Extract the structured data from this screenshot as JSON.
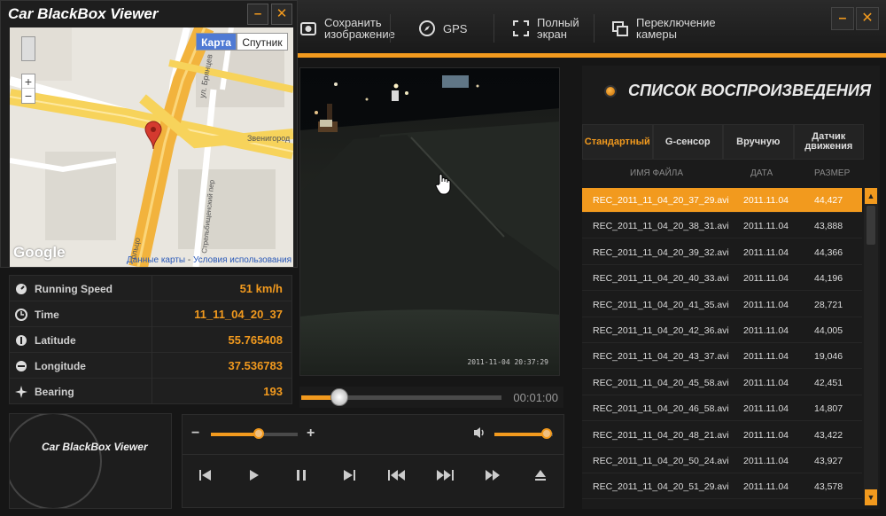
{
  "app": {
    "title": "Car BlackBox Viewer",
    "minimize": "–",
    "close": "✕"
  },
  "toolbar": {
    "save": "Сохранить изображение",
    "gps": "GPS",
    "fullscreen": "Полный экран",
    "switch_camera": "Переключение камеры"
  },
  "map": {
    "type_map": "Карта",
    "type_satellite": "Спутник",
    "zoom_in": "+",
    "zoom_out": "−",
    "google": "Google",
    "map_data": "Данные карты",
    "separator": "-",
    "terms": "Условия использования",
    "streets": [
      "ул. Брянцев",
      "Звенигород",
      "Стрельбищенский пер",
      "ольцо"
    ]
  },
  "telemetry": [
    {
      "label": "Running Speed",
      "value": "51 km/h",
      "icon": "speed-icon"
    },
    {
      "label": "Time",
      "value": "11_11_04_20_37",
      "icon": "clock-icon"
    },
    {
      "label": "Latitude",
      "value": "55.765408",
      "icon": "latitude-icon"
    },
    {
      "label": "Longitude",
      "value": "37.536783",
      "icon": "longitude-icon"
    },
    {
      "label": "Bearing",
      "value": "193",
      "icon": "bearing-icon"
    }
  ],
  "logo": {
    "text": "Car BlackBox Viewer"
  },
  "video": {
    "osd": "2011-11-04 20:37:29",
    "progress": 0.19,
    "time": "00:01:00"
  },
  "controls": {
    "zoom_minus": "−",
    "zoom_plus": "+",
    "zoom_level": 0.55,
    "volume_level": 0.9
  },
  "playlist": {
    "title": "СПИСОК ВОСПРОИЗВЕДЕНИЯ",
    "tabs": [
      "Стандартный",
      "G-сенсор",
      "Вручную",
      "Датчик движения"
    ],
    "columns": [
      "ИМЯ ФАЙЛА",
      "ДАТА",
      "РАЗМЕР"
    ],
    "selected_index": 0,
    "rows": [
      {
        "name": "REC_2011_11_04_20_37_29.avi",
        "date": "2011.11.04",
        "size": "44,427"
      },
      {
        "name": "REC_2011_11_04_20_38_31.avi",
        "date": "2011.11.04",
        "size": "43,888"
      },
      {
        "name": "REC_2011_11_04_20_39_32.avi",
        "date": "2011.11.04",
        "size": "44,366"
      },
      {
        "name": "REC_2011_11_04_20_40_33.avi",
        "date": "2011.11.04",
        "size": "44,196"
      },
      {
        "name": "REC_2011_11_04_20_41_35.avi",
        "date": "2011.11.04",
        "size": "28,721"
      },
      {
        "name": "REC_2011_11_04_20_42_36.avi",
        "date": "2011.11.04",
        "size": "44,005"
      },
      {
        "name": "REC_2011_11_04_20_43_37.avi",
        "date": "2011.11.04",
        "size": "19,046"
      },
      {
        "name": "REC_2011_11_04_20_45_58.avi",
        "date": "2011.11.04",
        "size": "42,451"
      },
      {
        "name": "REC_2011_11_04_20_46_58.avi",
        "date": "2011.11.04",
        "size": "14,807"
      },
      {
        "name": "REC_2011_11_04_20_48_21.avi",
        "date": "2011.11.04",
        "size": "43,422"
      },
      {
        "name": "REC_2011_11_04_20_50_24.avi",
        "date": "2011.11.04",
        "size": "43,927"
      },
      {
        "name": "REC_2011_11_04_20_51_29.avi",
        "date": "2011.11.04",
        "size": "43,578"
      }
    ]
  },
  "colors": {
    "accent": "#f29a1e",
    "background": "#161616"
  }
}
